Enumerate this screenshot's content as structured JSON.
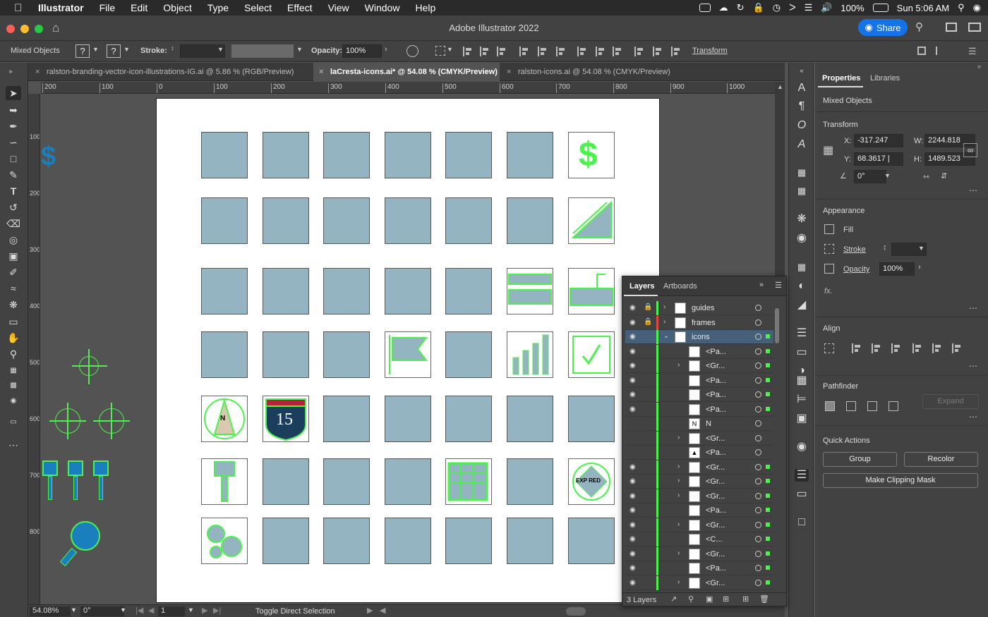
{
  "menubar": {
    "app": "Illustrator",
    "items": [
      "File",
      "Edit",
      "Object",
      "Type",
      "Select",
      "Effect",
      "View",
      "Window",
      "Help"
    ],
    "battery": "100%",
    "clock": "Sun 5:06 AM"
  },
  "window": {
    "title": "Adobe Illustrator 2022",
    "share_label": "Share"
  },
  "controlbar": {
    "selection_label": "Mixed Objects",
    "q1": "?",
    "q2": "?",
    "stroke_label": "Stroke:",
    "opacity_label": "Opacity:",
    "opacity_value": "100%",
    "transform_label": "Transform"
  },
  "tabs": [
    {
      "label": "ralston-branding-vector-icon-illustrations-IG.ai @ 5.86 % (RGB/Preview)",
      "active": false
    },
    {
      "label": "laCresta-icons.ai* @ 54.08 % (CMYK/Preview)",
      "active": true
    },
    {
      "label": "ralston-icons.ai @ 54.08 % (CMYK/Preview)",
      "active": false
    }
  ],
  "ruler": {
    "h_ticks": [
      "200",
      "100",
      "0",
      "100",
      "200",
      "300",
      "400",
      "500",
      "600",
      "700",
      "800",
      "900",
      "1000"
    ],
    "v_ticks": [
      "100",
      "200",
      "300",
      "400",
      "500",
      "600",
      "700",
      "800"
    ]
  },
  "artboard_icons": {
    "highway_number": "15",
    "compass_letter": "N",
    "expired_text": "EXP RED"
  },
  "status": {
    "zoom": "54.08%",
    "rotation": "0°",
    "artboard": "1",
    "tool_hint": "Toggle Direct Selection"
  },
  "properties": {
    "tab_properties": "Properties",
    "tab_libraries": "Libraries",
    "selection": "Mixed Objects",
    "transform_title": "Transform",
    "x_label": "X:",
    "x_value": "-317.247",
    "y_label": "Y:",
    "y_value": "68.3617 |",
    "w_label": "W:",
    "w_value": "2244.818",
    "h_label": "H:",
    "h_value": "1489.523",
    "angle_value": "0°",
    "appearance_title": "Appearance",
    "fill_label": "Fill",
    "stroke_label": "Stroke",
    "opacity_label": "Opacity",
    "opacity_value": "100%",
    "fx_label": "fx.",
    "align_title": "Align",
    "pathfinder_title": "Pathfinder",
    "expand_label": "Expand",
    "quick_actions_title": "Quick Actions",
    "group_label": "Group",
    "recolor_label": "Recolor",
    "clipping_label": "Make Clipping Mask"
  },
  "layers": {
    "tab_layers": "Layers",
    "tab_artboards": "Artboards",
    "footer_count": "3 Layers",
    "rows": [
      {
        "name": "guides",
        "eye": true,
        "lock": true,
        "arrow": "›",
        "indent": 0,
        "color": "#4cf24c",
        "thumb": "",
        "selected": false,
        "selsq": false
      },
      {
        "name": "frames",
        "eye": true,
        "lock": true,
        "arrow": "›",
        "indent": 0,
        "color": "#e04848",
        "thumb": "",
        "selected": false,
        "selsq": false
      },
      {
        "name": "icons",
        "eye": true,
        "lock": false,
        "arrow": "⌄",
        "indent": 0,
        "color": "#4cf24c",
        "thumb": "",
        "selected": true,
        "selsq": true
      },
      {
        "name": "<Pa...",
        "eye": true,
        "lock": false,
        "arrow": "",
        "indent": 1,
        "color": "#4cf24c",
        "thumb": "",
        "selected": false,
        "selsq": true
      },
      {
        "name": "<Gr...",
        "eye": true,
        "lock": false,
        "arrow": "›",
        "indent": 1,
        "color": "#4cf24c",
        "thumb": "",
        "selected": false,
        "selsq": true
      },
      {
        "name": "<Pa...",
        "eye": true,
        "lock": false,
        "arrow": "",
        "indent": 1,
        "color": "#4cf24c",
        "thumb": "",
        "selected": false,
        "selsq": true
      },
      {
        "name": "<Pa...",
        "eye": true,
        "lock": false,
        "arrow": "",
        "indent": 1,
        "color": "#4cf24c",
        "thumb": "",
        "selected": false,
        "selsq": true
      },
      {
        "name": "<Pa...",
        "eye": true,
        "lock": false,
        "arrow": "",
        "indent": 1,
        "color": "#4cf24c",
        "thumb": "",
        "selected": false,
        "selsq": true
      },
      {
        "name": "N",
        "eye": false,
        "lock": false,
        "arrow": "",
        "indent": 1,
        "color": "#4cf24c",
        "thumb": "N",
        "selected": false,
        "selsq": false
      },
      {
        "name": "<Gr...",
        "eye": false,
        "lock": false,
        "arrow": "›",
        "indent": 1,
        "color": "#4cf24c",
        "thumb": "",
        "selected": false,
        "selsq": false
      },
      {
        "name": "<Pa...",
        "eye": false,
        "lock": false,
        "arrow": "",
        "indent": 1,
        "color": "#4cf24c",
        "thumb": "▲",
        "selected": false,
        "selsq": false
      },
      {
        "name": "<Gr...",
        "eye": true,
        "lock": false,
        "arrow": "›",
        "indent": 1,
        "color": "#4cf24c",
        "thumb": "",
        "selected": false,
        "selsq": true
      },
      {
        "name": "<Gr...",
        "eye": true,
        "lock": false,
        "arrow": "›",
        "indent": 1,
        "color": "#4cf24c",
        "thumb": "",
        "selected": false,
        "selsq": true
      },
      {
        "name": "<Gr...",
        "eye": true,
        "lock": false,
        "arrow": "›",
        "indent": 1,
        "color": "#4cf24c",
        "thumb": "",
        "selected": false,
        "selsq": true
      },
      {
        "name": "<Pa...",
        "eye": true,
        "lock": false,
        "arrow": "",
        "indent": 1,
        "color": "#4cf24c",
        "thumb": "",
        "selected": false,
        "selsq": true
      },
      {
        "name": "<Gr...",
        "eye": true,
        "lock": false,
        "arrow": "›",
        "indent": 1,
        "color": "#4cf24c",
        "thumb": "",
        "selected": false,
        "selsq": true
      },
      {
        "name": "<C...",
        "eye": true,
        "lock": false,
        "arrow": "",
        "indent": 1,
        "color": "#4cf24c",
        "thumb": "",
        "selected": false,
        "selsq": true
      },
      {
        "name": "<Gr...",
        "eye": true,
        "lock": false,
        "arrow": "›",
        "indent": 1,
        "color": "#4cf24c",
        "thumb": "",
        "selected": false,
        "selsq": true
      },
      {
        "name": "<Pa...",
        "eye": true,
        "lock": false,
        "arrow": "",
        "indent": 1,
        "color": "#4cf24c",
        "thumb": "",
        "selected": false,
        "selsq": true
      },
      {
        "name": "<Gr...",
        "eye": true,
        "lock": false,
        "arrow": "›",
        "indent": 1,
        "color": "#4cf24c",
        "thumb": "",
        "selected": false,
        "selsq": true
      }
    ]
  },
  "colors": {
    "selection": "#4cf24c",
    "placeholder_tile": "#95b4c1",
    "accent": "#1473e6"
  }
}
